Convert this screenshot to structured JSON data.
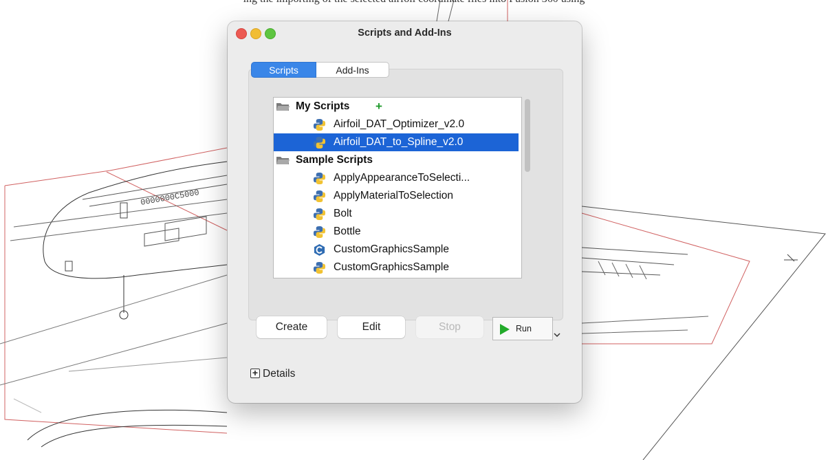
{
  "caption": "ing the importing of the selected airfoil coordinate files into Fusion 360 using",
  "window": {
    "title": "Scripts and Add-Ins",
    "tabs": [
      {
        "label": "Scripts",
        "active": true
      },
      {
        "label": "Add-Ins",
        "active": false
      }
    ],
    "list": {
      "groups": [
        {
          "label": "My Scripts"
        },
        {
          "label": "Sample Scripts"
        }
      ],
      "items": [
        {
          "label": "Airfoil_DAT_Optimizer_v2.0",
          "icon": "python-icon",
          "selected": false
        },
        {
          "label": "Airfoil_DAT_to_Spline_v2.0",
          "icon": "python-icon",
          "selected": true
        },
        {
          "label": "ApplyAppearanceToSelecti...",
          "icon": "python-icon",
          "selected": false
        },
        {
          "label": "ApplyMaterialToSelection",
          "icon": "python-icon",
          "selected": false
        },
        {
          "label": "Bolt",
          "icon": "python-icon",
          "selected": false
        },
        {
          "label": "Bottle",
          "icon": "python-icon",
          "selected": false
        },
        {
          "label": "CustomGraphicsSample",
          "icon": "cpp-icon",
          "selected": false
        },
        {
          "label": "CustomGraphicsSample",
          "icon": "python-icon",
          "selected": false
        }
      ]
    },
    "buttons": {
      "create": "Create",
      "edit": "Edit",
      "stop": "Stop",
      "run": "Run"
    },
    "details": "Details"
  },
  "colors": {
    "selection": "#1c64d6",
    "tab_active": "#3a86e8",
    "run_triangle": "#22aa2a"
  }
}
